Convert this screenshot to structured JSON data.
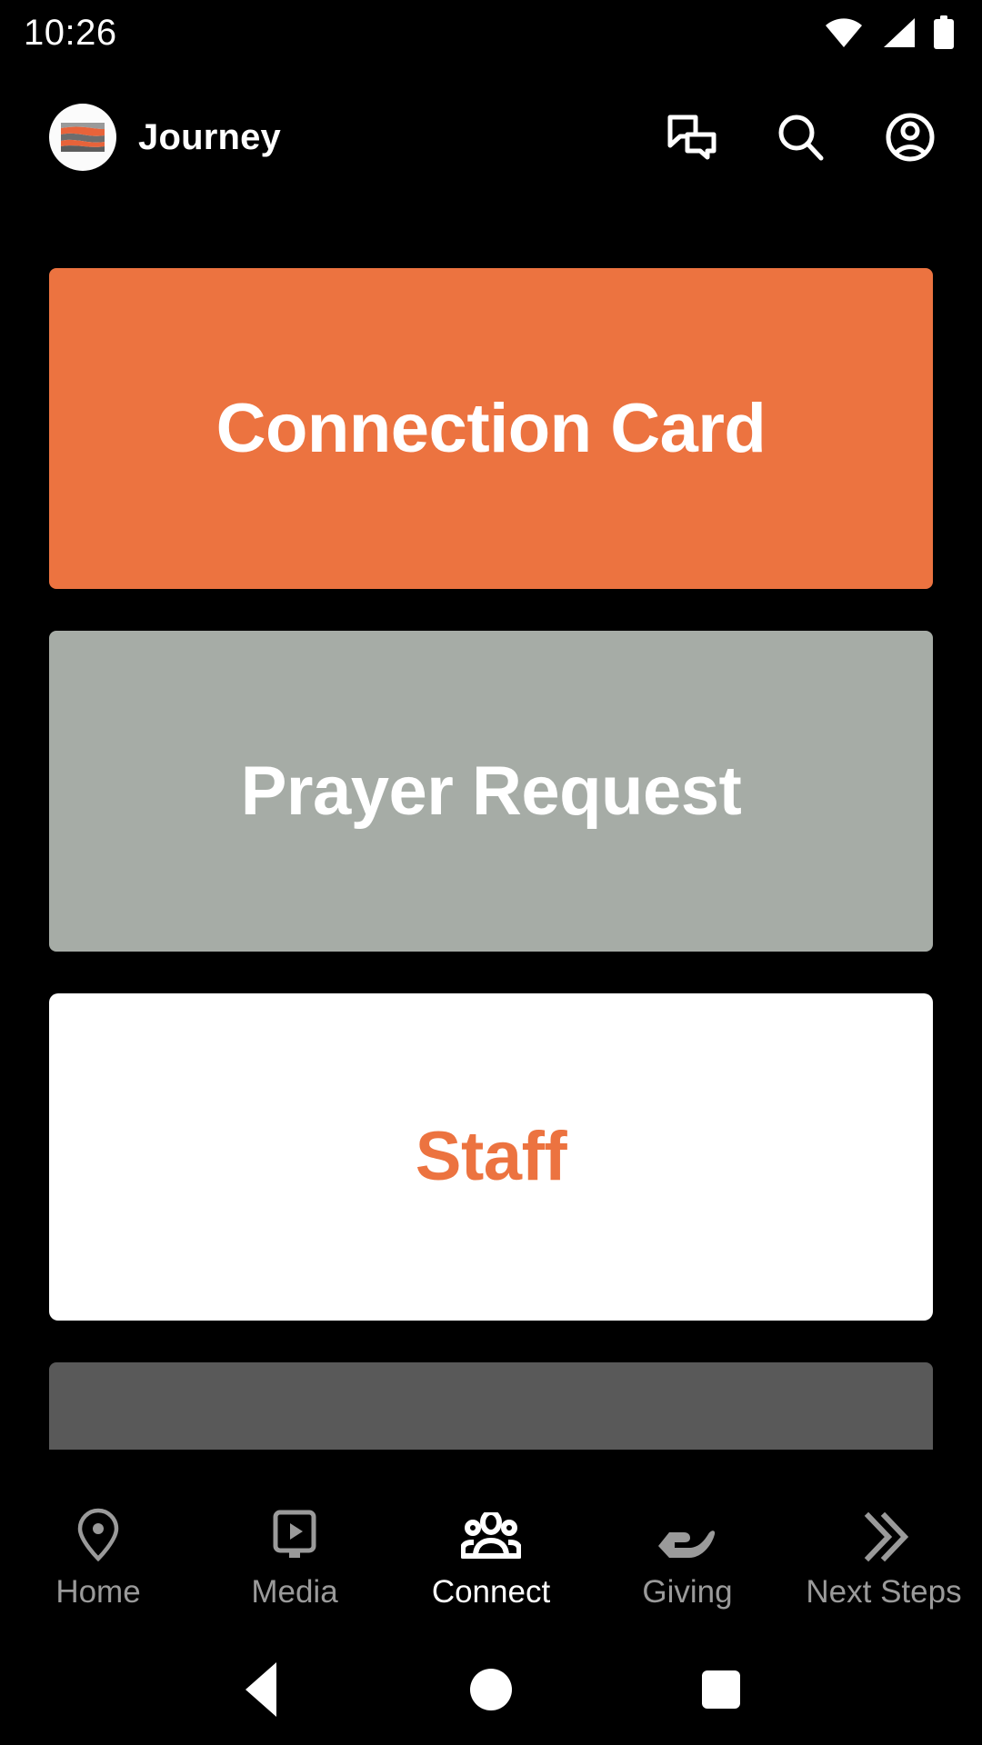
{
  "status_bar": {
    "time": "10:26",
    "icons": [
      "wifi-icon",
      "cellular-signal-icon",
      "battery-icon"
    ]
  },
  "header": {
    "app_title": "Journey",
    "logo_icon": "journey-logo-icon",
    "actions": [
      {
        "name": "chat-icon",
        "label": "Chat"
      },
      {
        "name": "search-icon",
        "label": "Search"
      },
      {
        "name": "account-icon",
        "label": "Account"
      }
    ]
  },
  "cards": [
    {
      "label": "Connection Card",
      "bg": "#EC7340",
      "fg": "#FFFFFF"
    },
    {
      "label": "Prayer Request",
      "bg": "#A6ACA6",
      "fg": "#FFFFFF"
    },
    {
      "label": "Staff",
      "bg": "#FFFFFF",
      "fg": "#EC7340"
    },
    {
      "label": "",
      "bg": "#595959",
      "fg": "#FFFFFF"
    }
  ],
  "tab_bar": {
    "active": "Connect",
    "items": [
      {
        "label": "Home",
        "icon": "location-pin-icon",
        "active": false
      },
      {
        "label": "Media",
        "icon": "tv-play-icon",
        "active": false
      },
      {
        "label": "Connect",
        "icon": "people-group-icon",
        "active": true
      },
      {
        "label": "Giving",
        "icon": "open-hand-icon",
        "active": false
      },
      {
        "label": "Next Steps",
        "icon": "double-chevron-right-icon",
        "active": false
      }
    ]
  },
  "android_nav": {
    "back": "back-button",
    "home": "home-button",
    "recents": "recents-button"
  },
  "colors": {
    "background": "#000000",
    "accent_orange": "#EC7340",
    "card_gray": "#A6ACA6",
    "card_dark_gray": "#595959",
    "inactive_tab": "#9A9A9A",
    "active_tab": "#FFFFFF"
  }
}
